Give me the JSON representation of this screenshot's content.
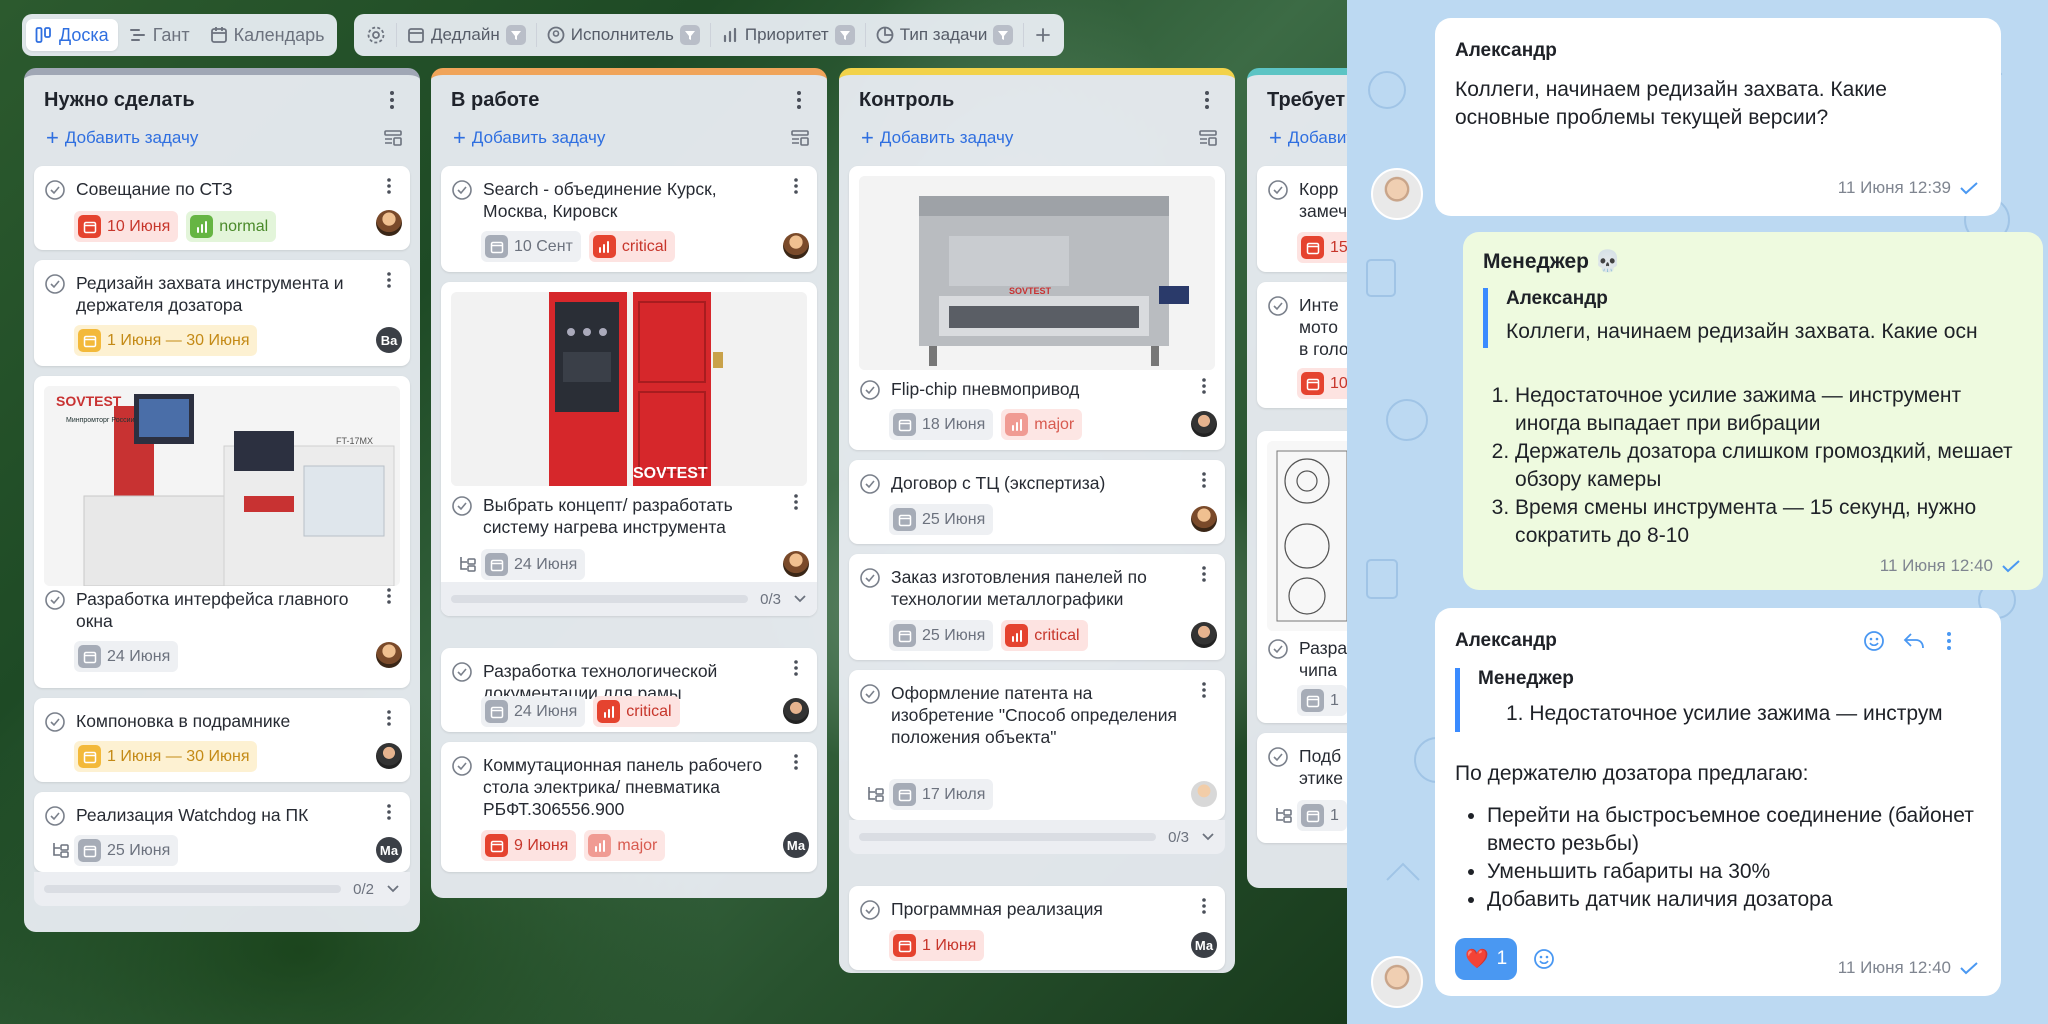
{
  "views": {
    "board": "Доска",
    "gantt": "Гант",
    "calendar": "Календарь"
  },
  "filters": {
    "deadline": "Дедлайн",
    "assignee": "Исполнитель",
    "priority": "Приоритет",
    "task_type": "Тип задачи"
  },
  "add_task_label": "Добавить задачу",
  "columns": [
    {
      "title": "Нужно сделать",
      "color": "#a0a7b5",
      "cards": [
        {
          "title": "Совещание по СТЗ",
          "date": "10 Июня",
          "priority": "normal"
        },
        {
          "title": "Редизайн захвата инструмента и держателя дозатора",
          "date": "1 Июня — 30 Июня",
          "avatar": "Ва"
        },
        {
          "title": "Разработка интерфейса главного окна",
          "date": "24 Июня"
        },
        {
          "title": "Компоновка в подрамнике",
          "date": "1 Июня — 30 Июня"
        },
        {
          "title": "Реализация Watchdog на ПК",
          "date": "25 Июня",
          "avatar": "Ма",
          "progress": "0/2"
        }
      ]
    },
    {
      "title": "В работе",
      "color": "#f0a45a",
      "cards": [
        {
          "title": "Search - объединение Курск, Москва, Кировск",
          "date": "10 Сент",
          "priority": "critical"
        },
        {
          "title": "Выбрать концепт/ разработать систему нагрева инструмента",
          "date": "24 Июня",
          "progress": "0/3"
        },
        {
          "title": "Разработка технологической документации для рамы",
          "date": "24 Июня",
          "priority": "critical"
        },
        {
          "title": "Коммутационная панель рабочего стола электрика/ пневматика РБФТ.306556.900",
          "date": "9 Июня",
          "priority": "major",
          "avatar": "Ма"
        }
      ]
    },
    {
      "title": "Контроль",
      "color": "#f2d24a",
      "cards": [
        {
          "title": "Flip-chip пневмопривод",
          "date": "18 Июня",
          "priority": "major"
        },
        {
          "title": "Договор с ТЦ (экспертиза)",
          "date": "25 Июня"
        },
        {
          "title": "Заказ изготовления панелей по технологии металлографики",
          "date": "25 Июня",
          "priority": "critical"
        },
        {
          "title": "Оформление патента на изобретение \"Способ определения положения объекта\"",
          "date": "17 Июля",
          "progress": "0/3"
        },
        {
          "title": "Программная реализация",
          "date": "1 Июня",
          "avatar": "Ма"
        }
      ]
    },
    {
      "title": "Требует",
      "color": "#5cc4c4",
      "cards": [
        {
          "title": "Корр замеч",
          "date": "15"
        },
        {
          "title": "Инте мото в голо",
          "date": "10"
        },
        {
          "title": "Разра чипа",
          "date": "1"
        },
        {
          "title": "Подб этике",
          "date": "1"
        }
      ]
    }
  ],
  "chat": {
    "messages": [
      {
        "author": "Александр",
        "text": "Коллеги, начинаем редизайн захвата. Какие основные проблемы текущей версии?",
        "time": "11 Июня 12:39"
      },
      {
        "author": "Менеджер 💀",
        "quote_author": "Александр",
        "quote_text": "Коллеги, начинаем редизайн захвата. Какие осн",
        "list": [
          "Недостаточное усилие зажима — инструмент иногда выпадает при вибрации",
          "Держатель дозатора слишком громоздкий, мешает обзору камеры",
          "Время смены инструмента — 15 секунд, нужно сократить до 8-10"
        ],
        "time": "11 Июня 12:40"
      },
      {
        "author": "Александр",
        "quote_author": "Менеджер",
        "quote_text": "1. Недостаточное усилие зажима — инструм",
        "intro": "По держателю дозатора предлагаю:",
        "list": [
          "Перейти на быстросъемное соединение (байонет вместо резьбы)",
          "Уменьшить габариты на 30%",
          "Добавить датчик наличия дозатора"
        ],
        "reaction": {
          "emoji": "❤️",
          "count": "1"
        },
        "time": "11 Июня 12:40"
      }
    ]
  },
  "product_labels": {
    "brand": "SOVTEST",
    "model": "FT-17MX",
    "minprom": "Минпромторг России"
  }
}
